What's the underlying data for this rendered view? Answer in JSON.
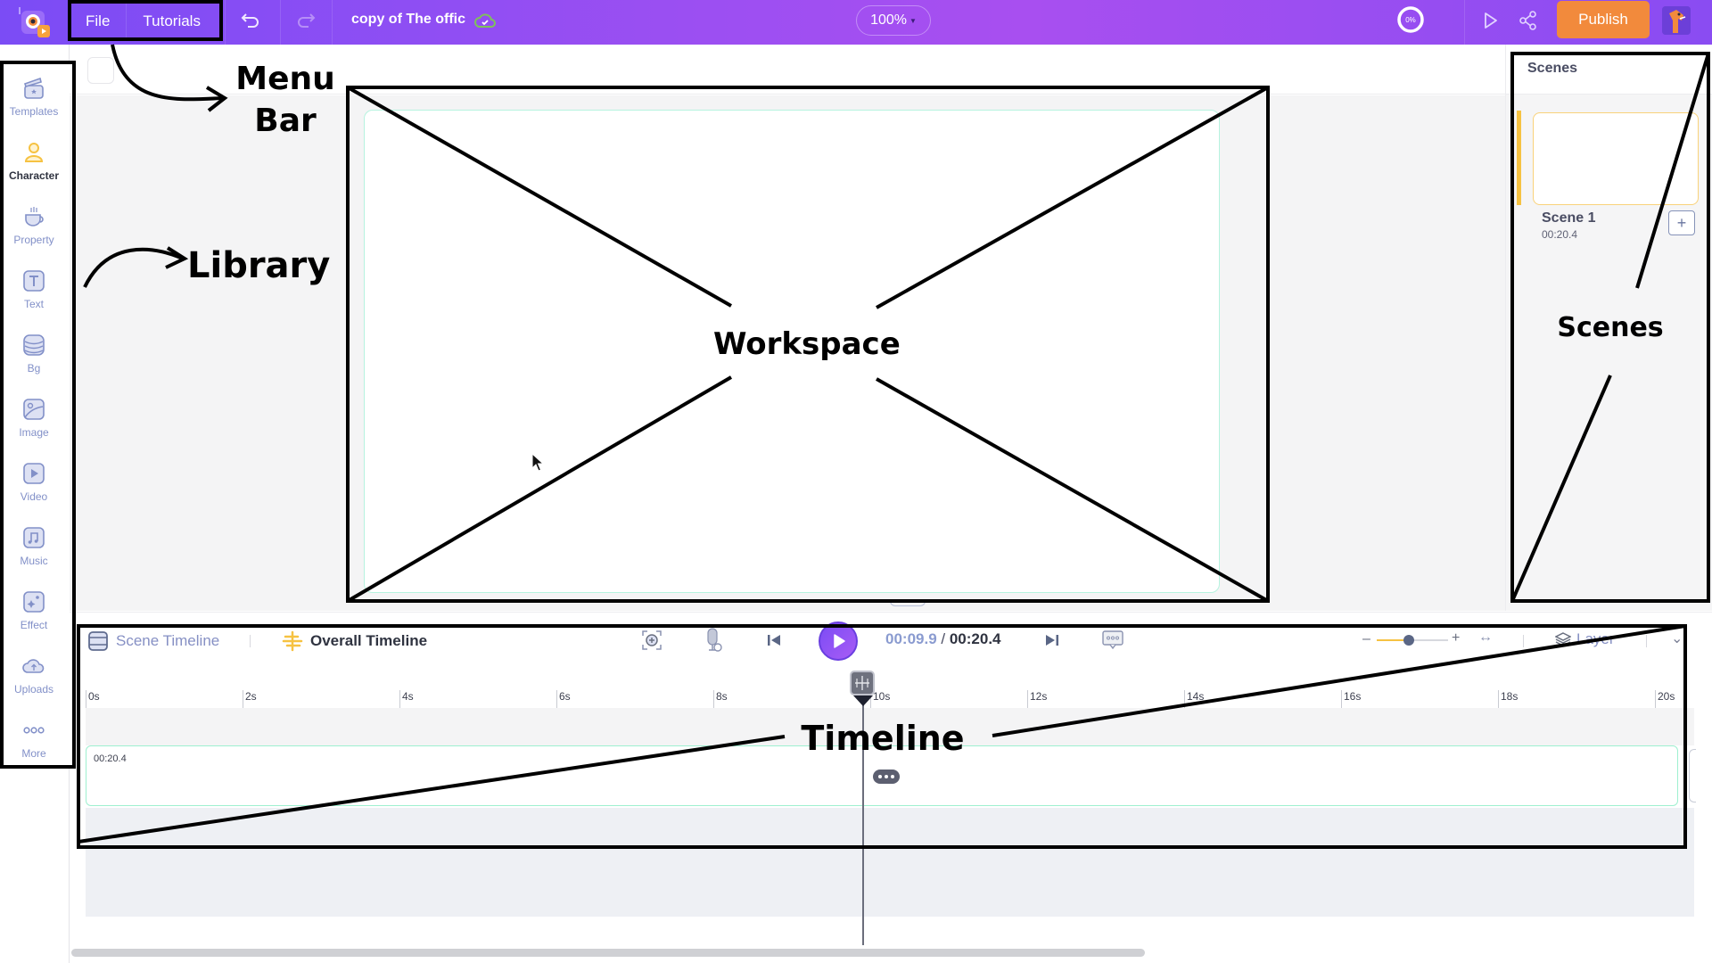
{
  "topbar": {
    "logo_icon": "animaker-logo-icon",
    "menu": [
      {
        "label": "File"
      },
      {
        "label": "Tutorials"
      }
    ],
    "undo_icon": "undo-icon",
    "redo_icon": "redo-icon",
    "document_title": "copy of The offic",
    "save_status_icon": "cloud-saved-icon",
    "zoom_level": "100%",
    "progress_percent": "0%",
    "preview_icon": "play-preview-icon",
    "share_icon": "share-icon",
    "publish_label": "Publish",
    "colors": {
      "bar_start": "#7b4cf5",
      "bar_mid": "#a84ff0",
      "publish": "#f28a3c"
    }
  },
  "sidebar": {
    "items": [
      {
        "label": "Templates",
        "icon": "clapperboard-icon",
        "active": false
      },
      {
        "label": "Character",
        "icon": "person-icon",
        "active": true
      },
      {
        "label": "Property",
        "icon": "cup-icon",
        "active": false
      },
      {
        "label": "Text",
        "icon": "text-icon",
        "active": false
      },
      {
        "label": "Bg",
        "icon": "layers-bg-icon",
        "active": false
      },
      {
        "label": "Image",
        "icon": "image-icon",
        "active": false
      },
      {
        "label": "Video",
        "icon": "video-icon",
        "active": false
      },
      {
        "label": "Music",
        "icon": "music-icon",
        "active": false
      },
      {
        "label": "Effect",
        "icon": "sparkle-icon",
        "active": false
      },
      {
        "label": "Uploads",
        "icon": "cloud-upload-icon",
        "active": false
      },
      {
        "label": "More",
        "icon": "more-dots-icon",
        "active": false
      }
    ]
  },
  "scenes": {
    "title": "Scenes",
    "items": [
      {
        "name": "Scene 1",
        "duration": "00:20.4",
        "selected": true
      }
    ],
    "add_label": "+"
  },
  "timeline": {
    "tabs": [
      {
        "label": "Scene Timeline",
        "icon": "scene-timeline-icon",
        "active": false
      },
      {
        "label": "Overall Timeline",
        "icon": "overall-timeline-icon",
        "active": true
      }
    ],
    "current_time": "00:09.9",
    "separator": " / ",
    "total_time": "00:20.4",
    "layer_label": "Layer",
    "zoom_slider_value": 0.45,
    "ruler_ticks": [
      "0s",
      "2s",
      "4s",
      "6s",
      "8s",
      "10s",
      "12s",
      "14s",
      "16s",
      "18s",
      "20s"
    ],
    "ruler_max_seconds": 20,
    "playhead_seconds": 9.9,
    "track": {
      "label": "00:20.4"
    }
  },
  "annotations": {
    "menu_bar": "Menu\nBar",
    "library": "Library",
    "workspace": "Workspace",
    "scenes": "Scenes",
    "timeline": "Timeline"
  }
}
